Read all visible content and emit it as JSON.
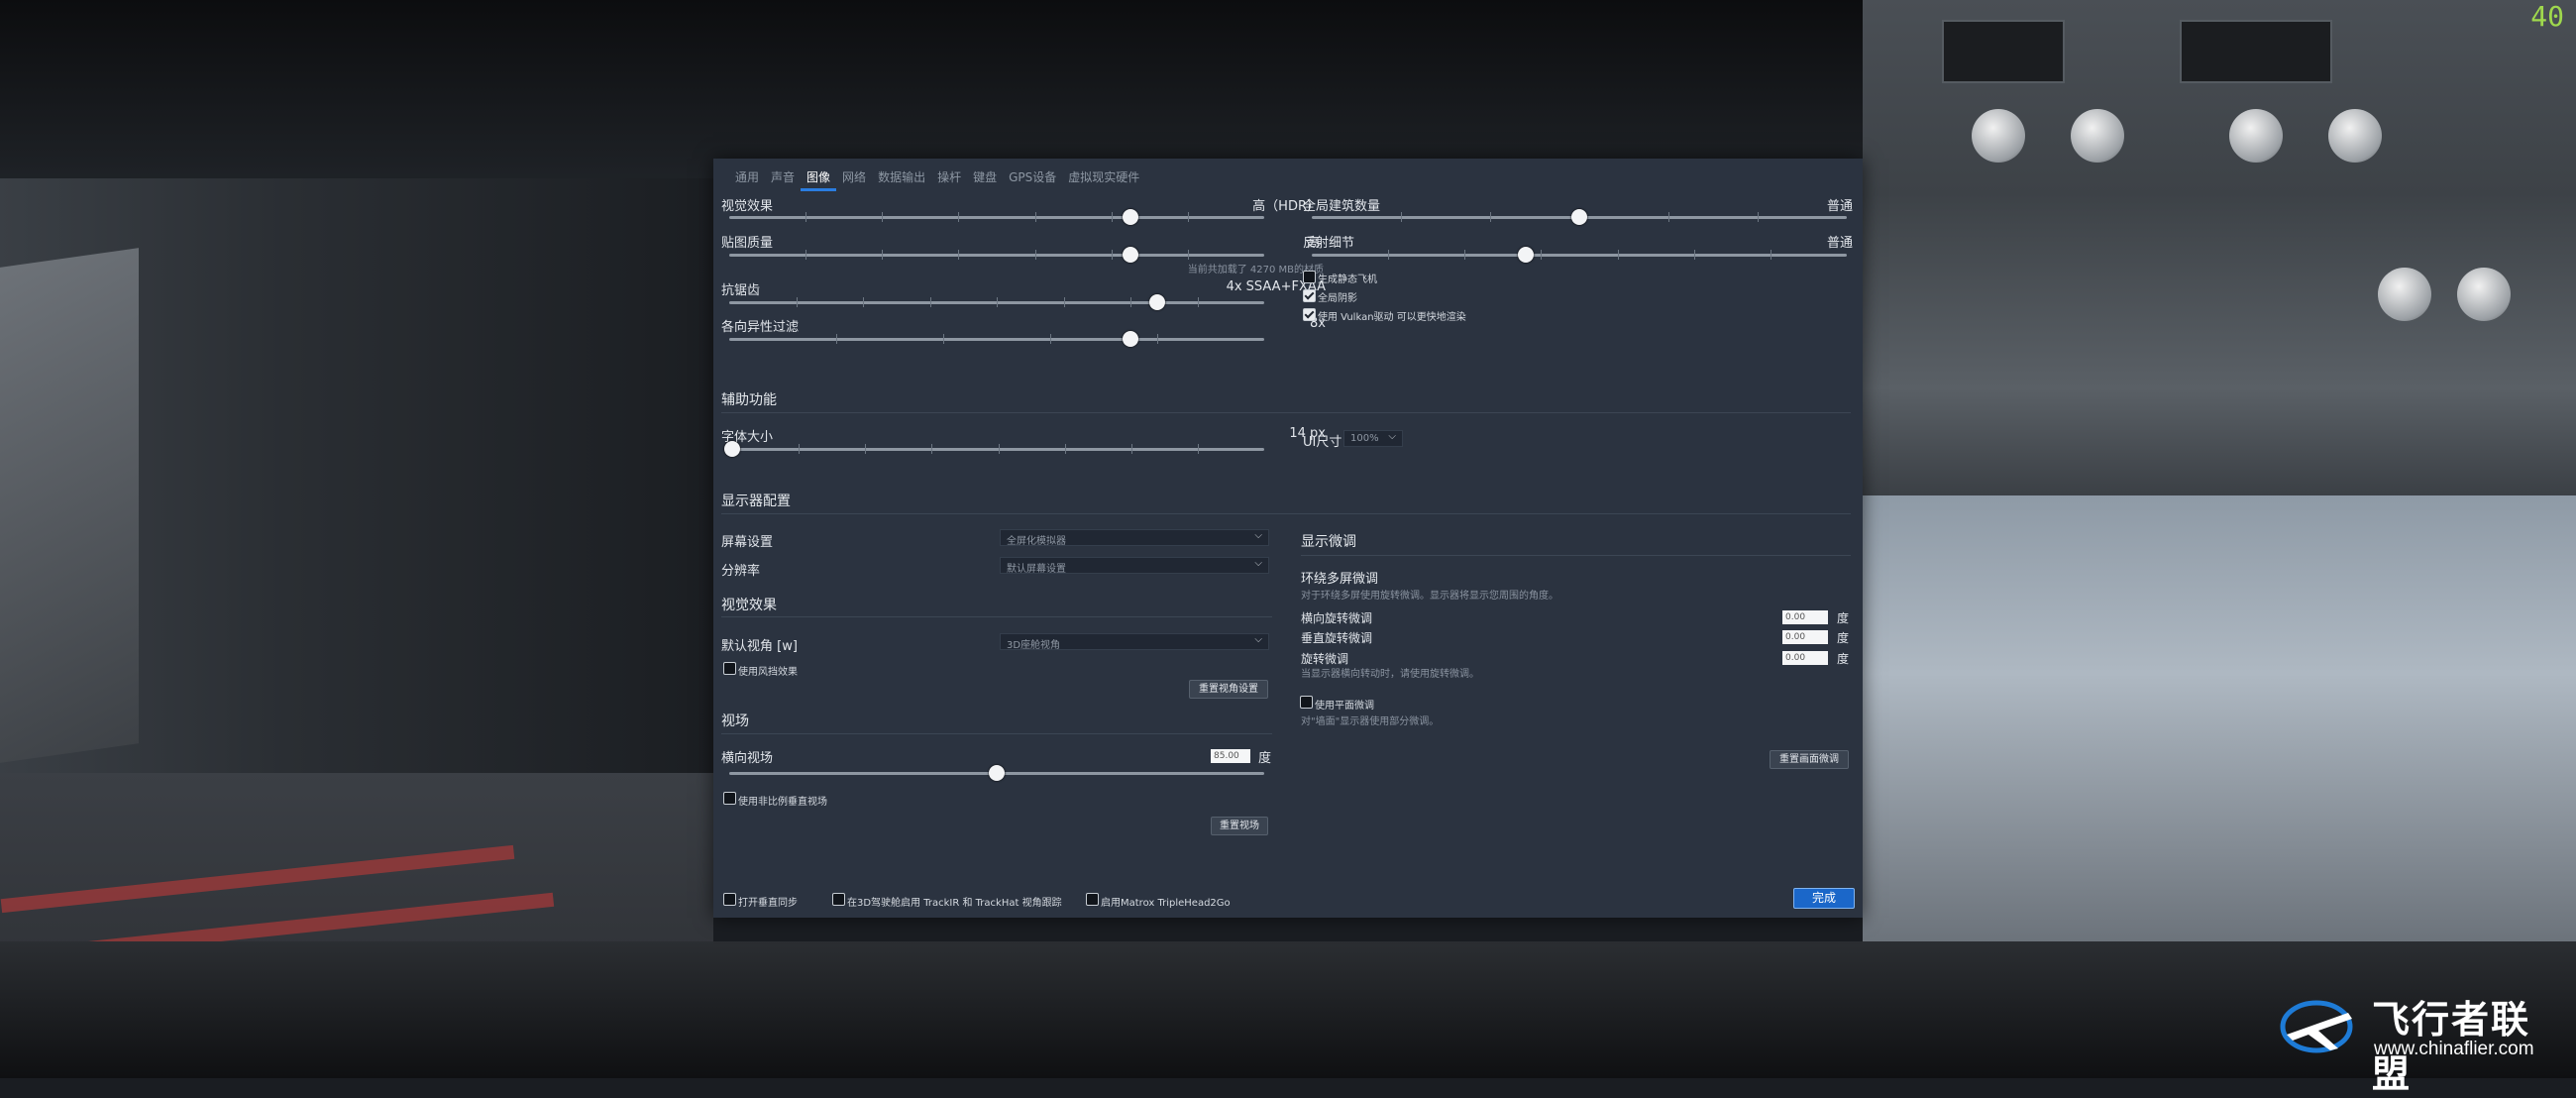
{
  "fps": "40",
  "watermark": {
    "title": "飞行者联盟",
    "url": "www.chinaflier.com"
  },
  "tabs": [
    "通用",
    "声音",
    "图像",
    "网络",
    "数据输出",
    "操杆",
    "键盘",
    "GPS设备",
    "虚拟现实硬件"
  ],
  "active_tab": "图像",
  "graphics": {
    "visual_effects": {
      "label": "视觉效果",
      "value": "高（HDR）",
      "level": 0.75
    },
    "texture_quality": {
      "label": "贴图质量",
      "value": "高",
      "note": "当前共加载了 4270 MB的材质",
      "level": 0.75
    },
    "antialiasing": {
      "label": "抗锯齿",
      "value": "4x SSAA+FXAA",
      "level": 0.8
    },
    "anisotropic": {
      "label": "各向异性过滤",
      "value": "8x",
      "level": 0.75
    },
    "world_objects": {
      "label": "全局建筑数量",
      "value": "普通",
      "level": 0.5
    },
    "reflection_detail": {
      "label": "反射细节",
      "value": "普通",
      "level": 0.4
    },
    "options": [
      {
        "label": "生成静态飞机",
        "checked": false
      },
      {
        "label": "全局阴影",
        "checked": true
      },
      {
        "label": "使用 Vulkan驱动 可以更快地渲染",
        "checked": true
      }
    ]
  },
  "accessibility": {
    "heading": "辅助功能",
    "font_size": {
      "label": "字体大小",
      "value": "14 px",
      "level": 0.0
    },
    "ui_size": {
      "label": "UI尺寸",
      "value": "100%"
    }
  },
  "monitor": {
    "heading": "显示器配置",
    "screen_label": "屏幕设置",
    "screen_value": "全屏化模拟器",
    "resolution_label": "分辨率",
    "resolution_value": "默认屏幕设置"
  },
  "view": {
    "heading": "视觉效果",
    "default_view_label": "默认视角 [w]",
    "default_view_value": "3D座舱视角",
    "wind_effect": "使用风挡效果",
    "reset_view_button": "重置视角设置"
  },
  "fov": {
    "heading": "视场",
    "horizontal_label": "横向视场",
    "horizontal_value": "85.00",
    "unit": "度",
    "level": 0.5,
    "nonproportional": "使用非比例垂直视场",
    "reset_button": "重置视场"
  },
  "fine_tune": {
    "heading": "显示微调",
    "sub_heading": "环绕多屏微调",
    "description": "对于环绕多屏使用旋转微调。显示器将显示您周围的角度。",
    "lateral_label": "横向旋转微调",
    "lateral_value": "0.00",
    "vertical_label": "垂直旋转微调",
    "vertical_value": "0.00",
    "rotation_label": "旋转微调",
    "rotation_value": "0.00",
    "rotation_note": "当显示器横向转动时，请使用旋转微调。",
    "unit": "度",
    "flat_label": "使用平面微调",
    "flat_note": "对\"墙面\"显示器使用部分微调。",
    "reset_button": "重置画面微调"
  },
  "footer": {
    "vsync": "打开垂直同步",
    "trackir": "在3D驾驶舱启用 TrackIR 和 TrackHat 视角跟踪",
    "matrox": "启用Matrox TripleHead2Go",
    "done_button": "完成"
  }
}
